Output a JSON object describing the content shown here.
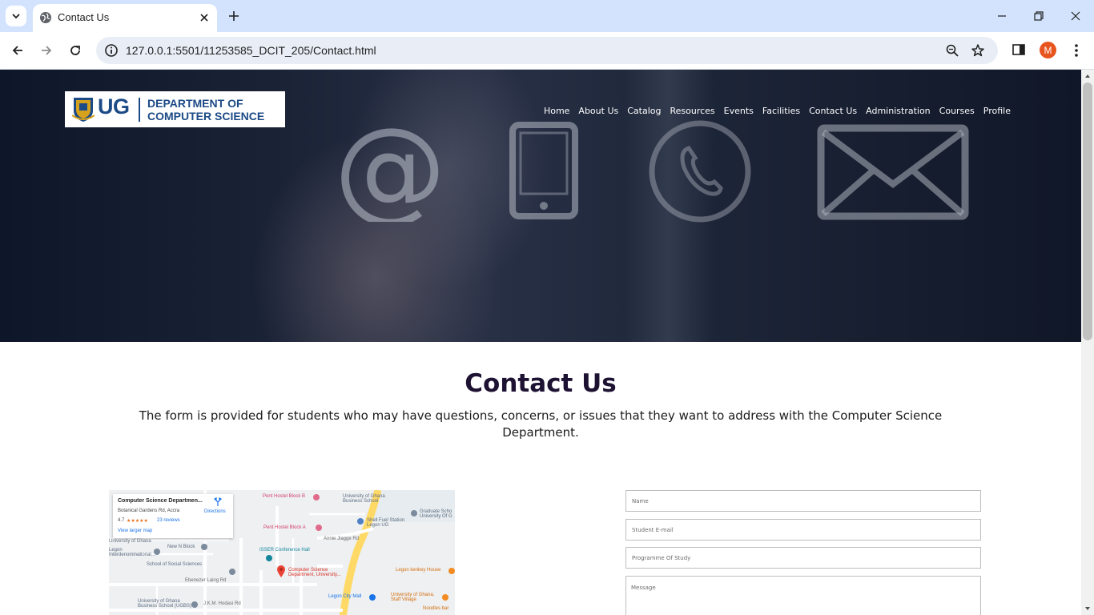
{
  "browser": {
    "tab_title": "Contact Us",
    "url": "127.0.0.1:5501/11253585_DCIT_205/Contact.html",
    "profile_initial": "M"
  },
  "logo": {
    "ug": "UG",
    "line1": "DEPARTMENT OF",
    "line2": "COMPUTER SCIENCE"
  },
  "nav": {
    "items": [
      {
        "label": "Home"
      },
      {
        "label": "About Us"
      },
      {
        "label": "Catalog"
      },
      {
        "label": "Resources"
      },
      {
        "label": "Events"
      },
      {
        "label": "Facilities"
      },
      {
        "label": "Contact Us"
      },
      {
        "label": "Administration"
      },
      {
        "label": "Courses"
      },
      {
        "label": "Profile"
      }
    ]
  },
  "contact": {
    "title": "Contact Us",
    "intro": "The form is provided for students who may have questions, concerns, or issues that they want to address with the Computer Science Department."
  },
  "map": {
    "place_title": "Computer Science Departmen...",
    "address": "Botanical Gardens Rd, Accra",
    "rating": "4.7",
    "stars": "★★★★★",
    "reviews": "23 reviews",
    "larger_map": "View larger map",
    "directions": "Directions",
    "labels": {
      "pent_b": "Pent Hostel Block B",
      "pent_a": "Pent Hostel Block A",
      "ug_business": "University of Ghana Business School",
      "shell": "Shell Fuel Station Legon UG",
      "graduate": "Graduate Scho University Of G",
      "isser": "ISSER Conference Hall",
      "new_n": "New N Block",
      "legon_denom": "Legon Interdenominational...",
      "univ_ghana": "University of Ghana",
      "social": "School of Social Sciences",
      "cs_dept": "Computer Science Department, University...",
      "kenkey": "Legon kenkey House",
      "ebenezer": "Ebenezer Laing Rd",
      "ugbs": "University of Ghana Business School (UGBS)",
      "jkm": "J.K.M. Hodasi Rd",
      "city_mall": "Legon City Mall",
      "staff_village": "University of Ghana, Staff Village",
      "noodles": "Noodles bar",
      "annie_jiagge": "Annie Jiagge Rd"
    },
    "colors": {
      "road": "#ffd966",
      "pin": "#ea4335",
      "place": "#7b8a9c",
      "food": "#f28b22"
    }
  },
  "form": {
    "name_placeholder": "Name",
    "email_placeholder": "Student E-mail",
    "programme_placeholder": "Programme Of Study",
    "message_placeholder": "Message"
  }
}
